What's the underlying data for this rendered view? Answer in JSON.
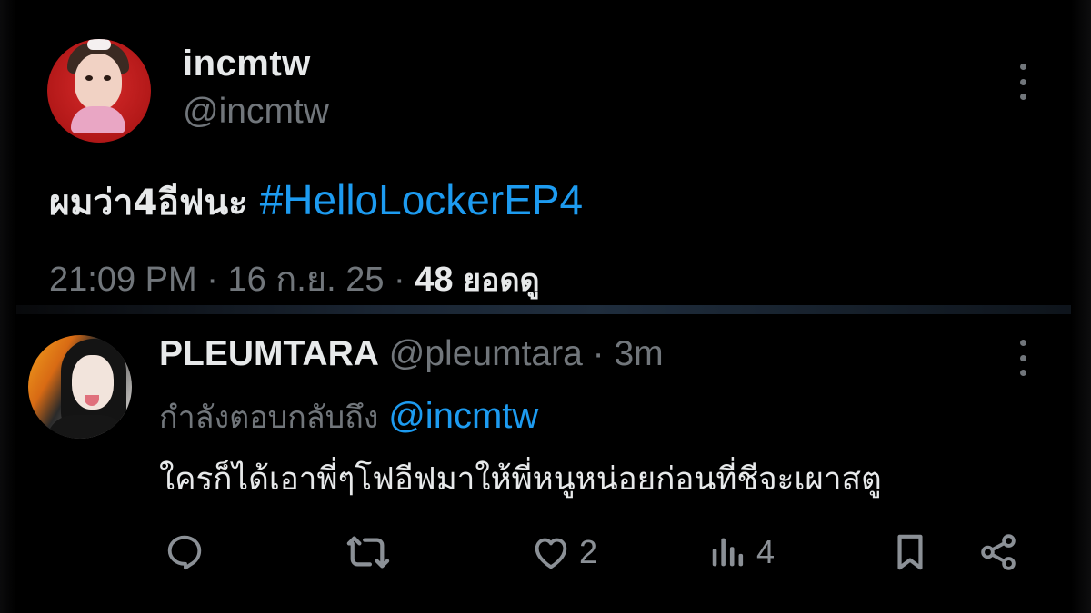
{
  "main_post": {
    "display_name": "incmtw",
    "handle": "@incmtw",
    "text_prefix": "ผมว่า4อีฟนะ ",
    "hashtag": "#HelloLockerEP4",
    "time": "21:09 PM",
    "sep1": " · ",
    "date": "16 ก.ย. 25",
    "sep2": " · ",
    "views_count": "48",
    "views_label": "ยอดดู"
  },
  "reply": {
    "display_name": "PLEUMTARA",
    "handle": "@pleumtara",
    "sep": " · ",
    "time": "3m",
    "replying_prefix": "กำลังตอบกลับถึง ",
    "replying_mention": "@incmtw",
    "text": "ใครก็ได้เอาพี่ๆโฟอีฟมาให้พี่หนูหน่อยก่อนที่ชีจะเผาสตู",
    "actions": {
      "likes": "2",
      "views": "4"
    }
  },
  "colors": {
    "background": "#000000",
    "text_primary": "#e7e9ea",
    "text_secondary": "#71767b",
    "link": "#1d9bf0"
  },
  "icons": [
    "more-vertical-icon",
    "reply-icon",
    "repost-icon",
    "like-icon",
    "views-icon",
    "bookmark-icon",
    "share-icon"
  ]
}
